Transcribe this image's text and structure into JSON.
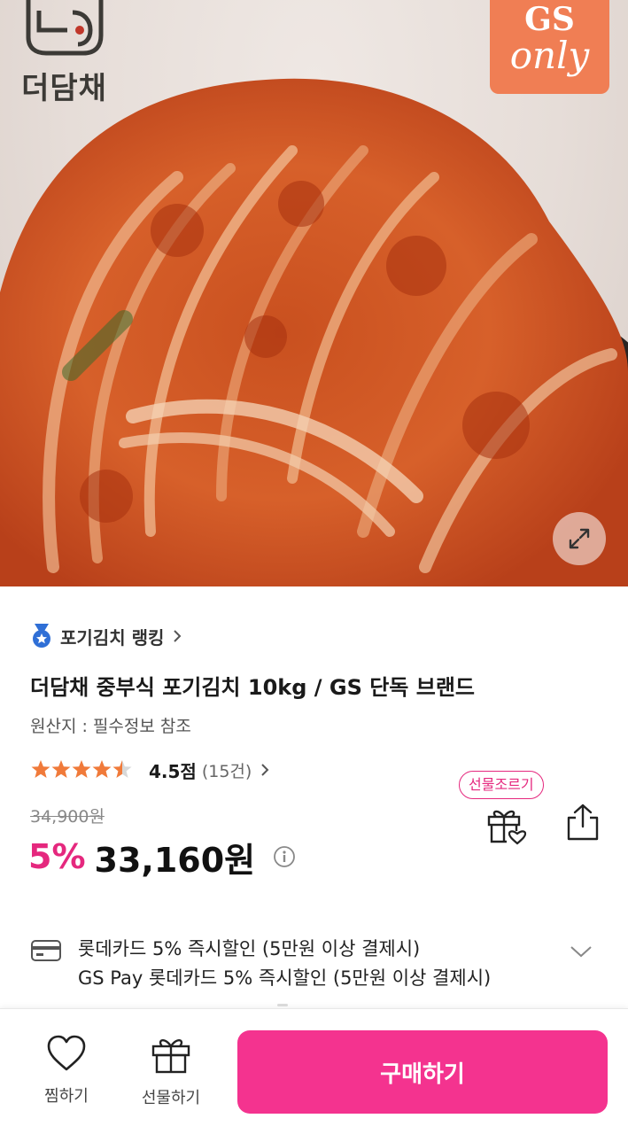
{
  "hero": {
    "brand_name": "더담채",
    "badge_line1": "GS",
    "badge_line2": "only"
  },
  "ranking": {
    "label": "포기김치 랭킹",
    "chevron": "›"
  },
  "product": {
    "title": "더담채 중부식 포기김치 10kg / GS 단독 브랜드",
    "origin": "원산지 : 필수정보 참조"
  },
  "rating": {
    "stars_filled": 4.5,
    "stars_total": 5,
    "score": "4.5점",
    "count": "(15건)",
    "star_color": "#f07a3a"
  },
  "price": {
    "original": "34,900원",
    "discount": "5%",
    "sale": "33,160원"
  },
  "actions": {
    "gift_request": "선물조르기"
  },
  "card_benefit": {
    "line1": "롯데카드 5% 즉시할인 (5만원 이상 결제시)",
    "line2": "GS Pay 롯데카드 5% 즉시할인 (5만원 이상 결제시)"
  },
  "bottom_bar": {
    "wishlist_label": "찜하기",
    "gift_label": "선물하기",
    "buy_label": "구매하기"
  },
  "colors": {
    "accent": "#e5287e",
    "buy_button": "#f4338f",
    "badge": "#f07e54",
    "ranking_icon": "#2f6fd6"
  },
  "icons": [
    "expand-icon",
    "ranking-medal-icon",
    "chevron-right-icon",
    "star-icon",
    "info-icon",
    "gift-icon",
    "share-icon",
    "card-icon",
    "chevron-down-icon",
    "heart-icon"
  ]
}
